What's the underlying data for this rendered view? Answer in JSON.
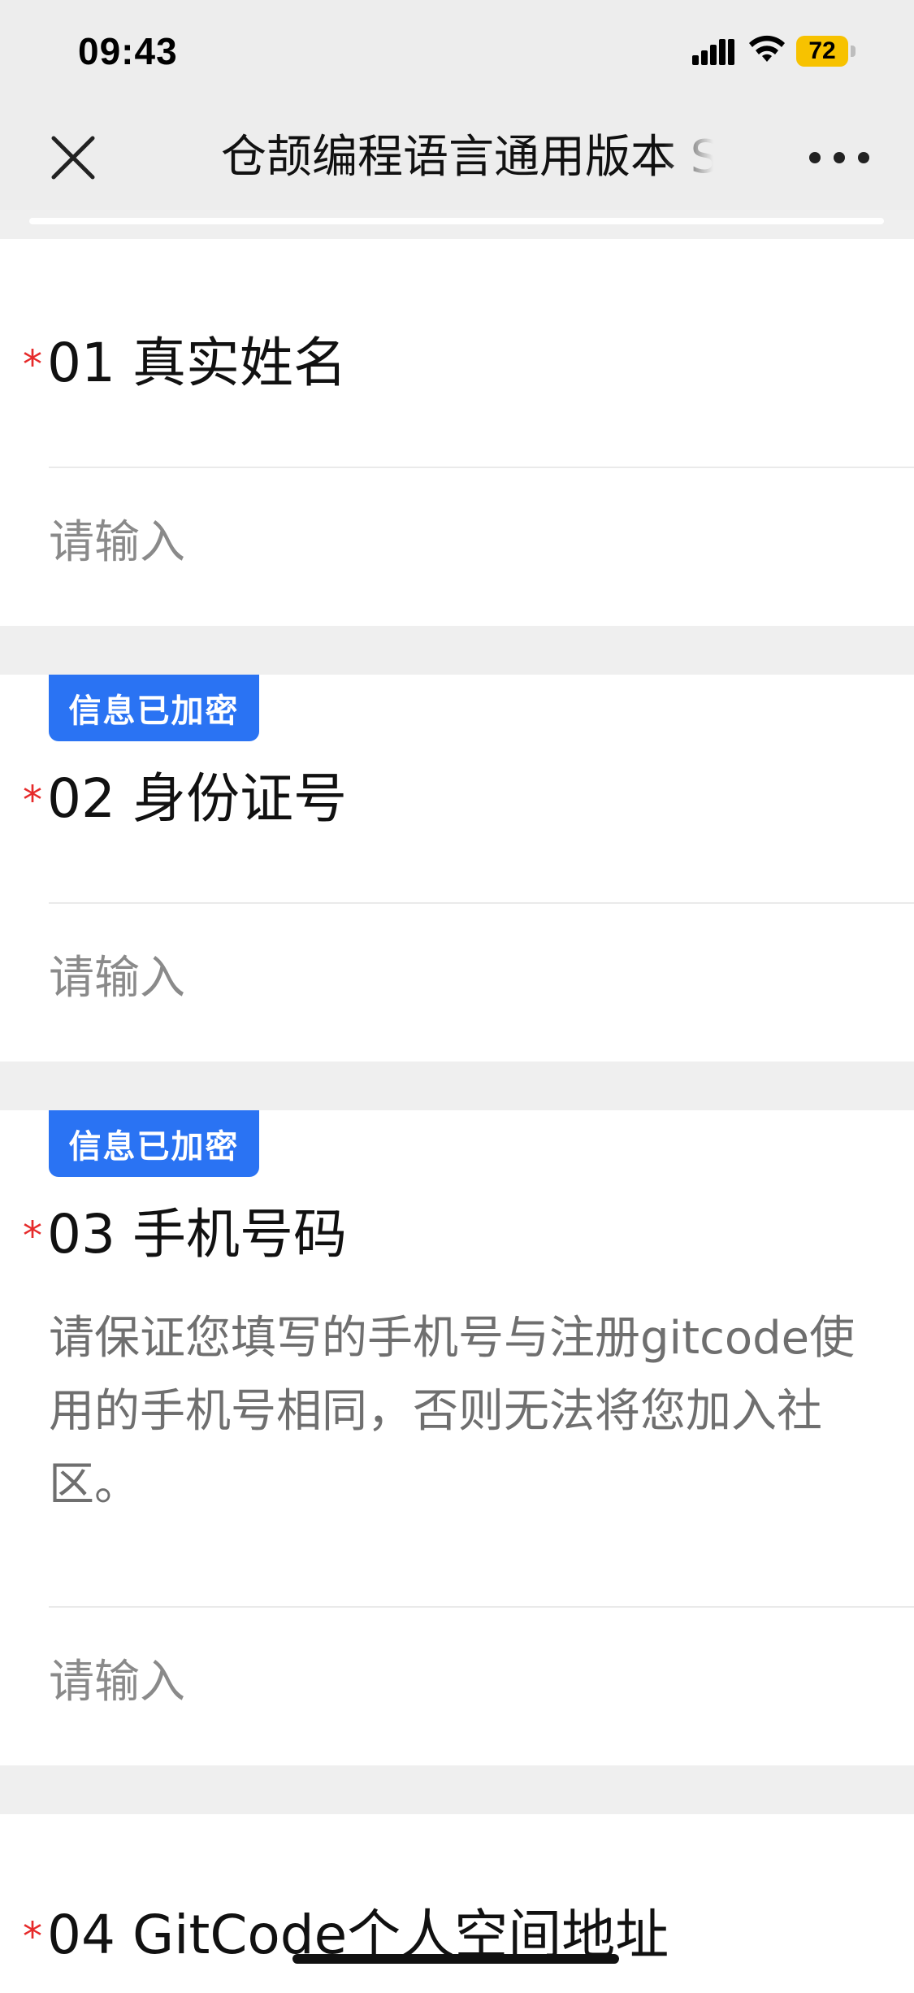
{
  "status_bar": {
    "time": "09:43",
    "battery": "72",
    "signal_icon": "cellular-signal-icon",
    "wifi_icon": "wifi-icon"
  },
  "nav": {
    "title": "仓颉编程语言通用版本 S",
    "close_icon": "close-icon",
    "more_icon": "more-icon"
  },
  "questions": [
    {
      "required": "*",
      "title": "01 真实姓名",
      "placeholder": "请输入"
    },
    {
      "required": "*",
      "badge": "信息已加密",
      "title": "02 身份证号",
      "placeholder": "请输入"
    },
    {
      "required": "*",
      "badge": "信息已加密",
      "title": "03 手机号码",
      "description": "请保证您填写的手机号与注册gitcode使用的手机号相同，否则无法将您加入社区。",
      "placeholder": "请输入"
    },
    {
      "required": "*",
      "title": "04 GitCode个人空间地址"
    }
  ],
  "colors": {
    "accent": "#2a73f3",
    "required": "#e62a2a",
    "background": "#efefef"
  }
}
